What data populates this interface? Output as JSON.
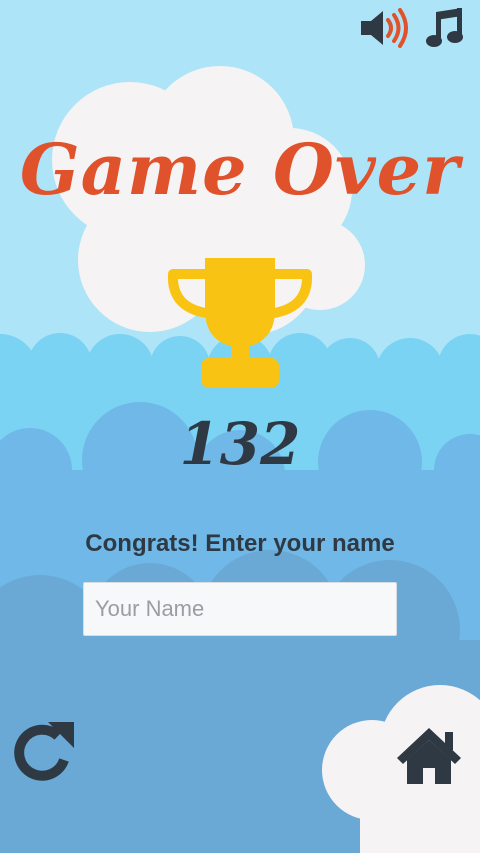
{
  "title": "Game Over",
  "score": "132",
  "prompt": "Congrats! Enter your name",
  "name_input": {
    "placeholder": "Your Name",
    "value": ""
  },
  "icons": {
    "sound": "speaker-icon",
    "music": "music-note-icon",
    "trophy": "trophy-icon",
    "restart": "restart-icon",
    "home": "home-icon"
  },
  "colors": {
    "sky": "#aee4f7",
    "title": "#e0522b",
    "trophy": "#f9c313",
    "text_dark": "#2f3943",
    "cloud": "#f6f3f4",
    "hills_1": "#7ad3f3",
    "hills_2": "#6fb8e8",
    "hills_3": "#6aa9d6"
  }
}
